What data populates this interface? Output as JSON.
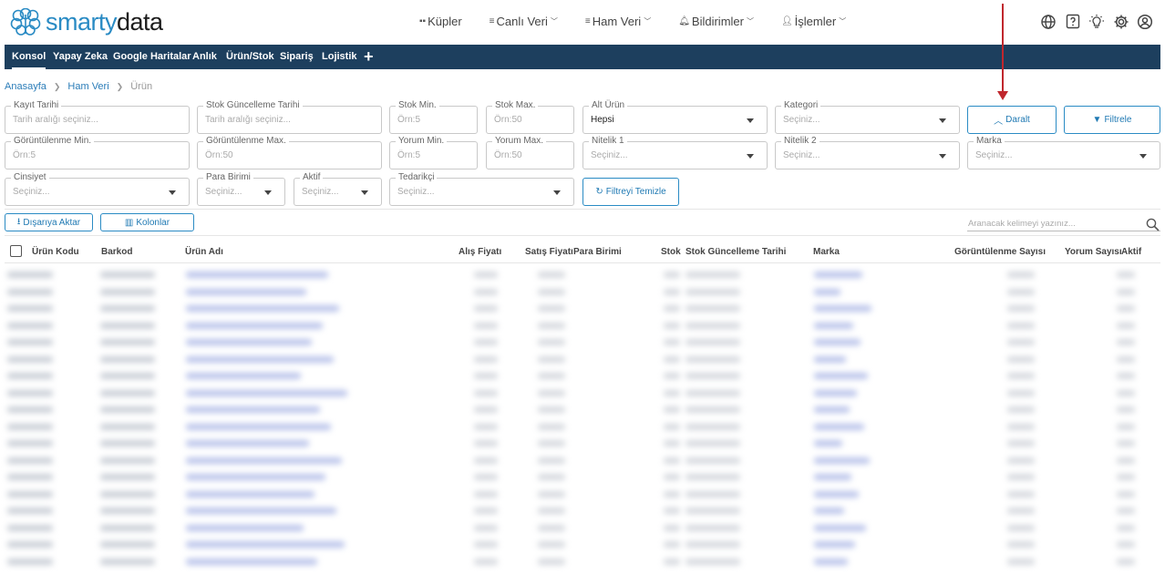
{
  "brand": {
    "name_light": "smarty",
    "name_bold": "data"
  },
  "topnav": [
    {
      "label": "Küpler",
      "icon": "grid-icon",
      "has_menu": false
    },
    {
      "label": "Canlı Veri",
      "icon": "lines-icon",
      "has_menu": true
    },
    {
      "label": "Ham Veri",
      "icon": "lines-icon",
      "has_menu": true
    },
    {
      "label": "Bildirimler",
      "icon": "bell-icon",
      "has_menu": true
    },
    {
      "label": "İşlemler",
      "icon": "user-icon",
      "has_menu": true
    }
  ],
  "tools": [
    "globe-icon",
    "help-icon",
    "lightbulb-icon",
    "gear-icon",
    "user-circle-icon"
  ],
  "tabs": [
    {
      "label": "Konsol",
      "active": true
    },
    {
      "label": "Yapay Zeka",
      "active": false
    },
    {
      "label": "Google Haritalar",
      "active": false
    },
    {
      "label": "Anlık",
      "active": false
    },
    {
      "label": "Ürün/Stok",
      "active": false
    },
    {
      "label": "Sipariş",
      "active": false
    },
    {
      "label": "Lojistik",
      "active": false
    }
  ],
  "tab_add": "+",
  "breadcrumb": {
    "home": "Anasayfa",
    "section": "Ham Veri",
    "current": "Ürün"
  },
  "filters": {
    "kayit_tarihi": {
      "label": "Kayıt Tarihi",
      "placeholder": "Tarih aralığı seçiniz..."
    },
    "stok_guncelleme": {
      "label": "Stok Güncelleme Tarihi",
      "placeholder": "Tarih aralığı seçiniz..."
    },
    "stok_min": {
      "label": "Stok Min.",
      "placeholder": "Örn:5"
    },
    "stok_max": {
      "label": "Stok Max.",
      "placeholder": "Örn:50"
    },
    "alt_urun": {
      "label": "Alt Ürün",
      "value": "Hepsi"
    },
    "kategori": {
      "label": "Kategori",
      "placeholder": "Seçiniz..."
    },
    "goruntulenme_min": {
      "label": "Görüntülenme Min.",
      "placeholder": "Örn:5"
    },
    "goruntulenme_max": {
      "label": "Görüntülenme Max.",
      "placeholder": "Örn:50"
    },
    "yorum_min": {
      "label": "Yorum Min.",
      "placeholder": "Örn:5"
    },
    "yorum_max": {
      "label": "Yorum Max.",
      "placeholder": "Örn:50"
    },
    "nitelik1": {
      "label": "Nitelik 1",
      "placeholder": "Seçiniz..."
    },
    "nitelik2": {
      "label": "Nitelik 2",
      "placeholder": "Seçiniz..."
    },
    "marka": {
      "label": "Marka",
      "placeholder": "Seçiniz..."
    },
    "cinsiyet": {
      "label": "Cinsiyet",
      "placeholder": "Seçiniz..."
    },
    "para_birimi": {
      "label": "Para Birimi",
      "placeholder": "Seçiniz..."
    },
    "aktif": {
      "label": "Aktif",
      "placeholder": "Seçiniz..."
    },
    "tedarikci": {
      "label": "Tedarikçi",
      "placeholder": "Seçiniz..."
    }
  },
  "buttons": {
    "daralt": "Daralt",
    "filtrele": "Filtrele",
    "filtreyi_temizle": "Filtreyi Temizle",
    "disariya_aktar": "Dışarıya Aktar",
    "kolonlar": "Kolonlar"
  },
  "search": {
    "placeholder": "Aranacak kelimeyi yazınız..."
  },
  "table": {
    "columns": [
      "Ürün Kodu",
      "Barkod",
      "Ürün Adı",
      "Alış Fiyatı",
      "Satış Fiyatı",
      "Para Birimi",
      "Stok",
      "Stok Güncelleme Tarihi",
      "Marka",
      "Görüntülenme Sayısı",
      "Yorum Sayısı",
      "Aktif"
    ],
    "rows_blurred": true
  },
  "colors": {
    "nav_bar": "#1d3f5e",
    "accent": "#2a8bc4",
    "annotation_arrow": "#c0272d"
  }
}
